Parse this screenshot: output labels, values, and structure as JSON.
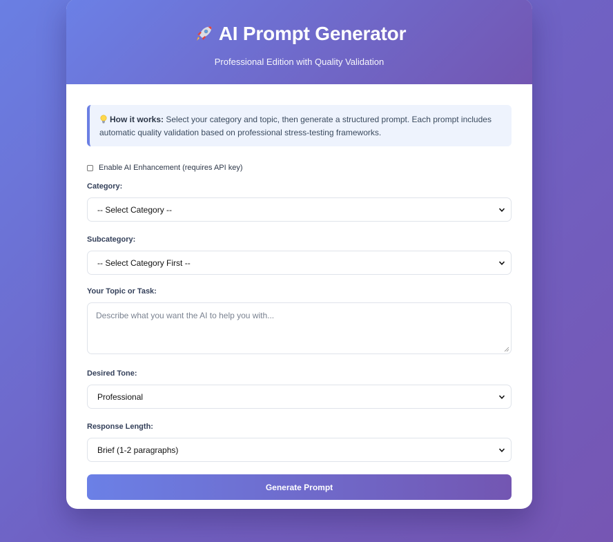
{
  "header": {
    "title": "AI Prompt Generator",
    "subtitle": "Professional Edition with Quality Validation",
    "icon": "rocket-icon"
  },
  "info": {
    "icon": "lightbulb-icon",
    "lead": "How it works:",
    "text": " Select your category and topic, then generate a structured prompt. Each prompt includes automatic quality validation based on professional stress-testing frameworks."
  },
  "ai_toggle": {
    "label": "Enable AI Enhancement (requires API key)",
    "checked": false
  },
  "fields": {
    "category": {
      "label": "Category:",
      "value": "-- Select Category --"
    },
    "subcategory": {
      "label": "Subcategory:",
      "value": "-- Select Category First --"
    },
    "topic": {
      "label": "Your Topic or Task:",
      "placeholder": "Describe what you want the AI to help you with..."
    },
    "tone": {
      "label": "Desired Tone:",
      "value": "Professional"
    },
    "length": {
      "label": "Response Length:",
      "value": "Brief (1-2 paragraphs)"
    }
  },
  "actions": {
    "generate_label": "Generate Prompt"
  },
  "colors": {
    "accent_start": "#6b80e6",
    "accent_end": "#7356b2",
    "info_bg": "#eef3fd"
  }
}
